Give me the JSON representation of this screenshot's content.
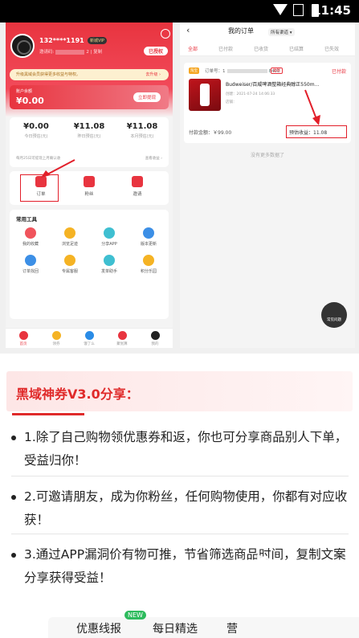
{
  "status_bar": {
    "time": "11:45"
  },
  "left_app": {
    "username": "132****1191",
    "vip_badge": "新城VIP",
    "invite_label": "邀请码:",
    "invite_code": "",
    "invite_suffix": "2 | 复制",
    "auth_button": "已授权",
    "notice": "升级黑域会员获得更多收益与特权。",
    "notice_link": "去升级 ›",
    "balance_label": "账户余额",
    "balance_value": "¥0.00",
    "withdraw_button": "立即提现",
    "stats": [
      {
        "value": "¥0.00",
        "label": "今日预估(元)"
      },
      {
        "value": "¥11.08",
        "label": "昨日预估(元)"
      },
      {
        "value": "¥11.08",
        "label": "本月预估(元)"
      }
    ],
    "stats_note": "每月25日可提现上月确认收",
    "stats_more": "查看收益 ›",
    "quick": [
      {
        "label": "订单",
        "icon": "order-icon"
      },
      {
        "label": "粉丝",
        "icon": "fans-icon"
      },
      {
        "label": "邀请",
        "icon": "invite-icon"
      }
    ],
    "tools_title": "常用工具",
    "tools": [
      {
        "label": "我的收藏",
        "icon": "star-icon",
        "color": "#f0545c"
      },
      {
        "label": "浏览足迹",
        "icon": "footprint-icon",
        "color": "#f5b324"
      },
      {
        "label": "分享APP",
        "icon": "share-icon",
        "color": "#3fbfd1"
      },
      {
        "label": "版本更新",
        "icon": "info-icon",
        "color": "#3c8fe6"
      },
      {
        "label": "订单找回",
        "icon": "search-icon",
        "color": "#3c8fe6"
      },
      {
        "label": "专属客服",
        "icon": "service-icon",
        "color": "#f5b324"
      },
      {
        "label": "发单助手",
        "icon": "assistant-icon",
        "color": "#3fbfd1"
      },
      {
        "label": "积分乐园",
        "icon": "points-icon",
        "color": "#f5b324"
      }
    ],
    "tabs": [
      {
        "label": "首页",
        "icon": "home-icon",
        "color": "#e8343f"
      },
      {
        "label": "领券",
        "icon": "coupon-icon",
        "color": "#f5b324"
      },
      {
        "label": "饿了么",
        "icon": "eleme-icon",
        "color": "#2a8ce6"
      },
      {
        "label": "聚划算",
        "icon": "deal-icon",
        "color": "#e8343f"
      },
      {
        "label": "我的",
        "icon": "profile-icon",
        "color": "#222222"
      }
    ]
  },
  "right_app": {
    "title": "我的订单",
    "channel": "所有渠道 ▾",
    "tabs": [
      "全部",
      "已付款",
      "已收货",
      "已结算",
      "已失效"
    ],
    "order": {
      "platform": "淘宝",
      "order_no": "订单号：1",
      "order_no_tail": "8402",
      "copy": "复制",
      "status": "已付款",
      "product": "Budweiser/百威啤酒整箱经典醇正550m...",
      "date": "创建：2021-07-24 14:06:33",
      "store": "店铺：",
      "paid": "付款金额：￥99.00",
      "estimate": "预估收益：11.08"
    },
    "no_more": "没有更多数据了",
    "fab": "常见问题"
  },
  "article": {
    "heading": "黑域神券V3.0分享：",
    "points": [
      "1.除了自己购物领优惠券和返，你也可分享商品别人下单，受益归你！",
      "2.可邀请朋友，成为你粉丝，任何购物使用，你都有对应收获！",
      "3.通过APP漏洞价有物可推，节省筛选商品时间，复制文案分享获得受益！"
    ]
  },
  "bottom_bar": {
    "items": [
      "优惠线报",
      "每日精选",
      "营"
    ],
    "new_badge": "NEW"
  }
}
